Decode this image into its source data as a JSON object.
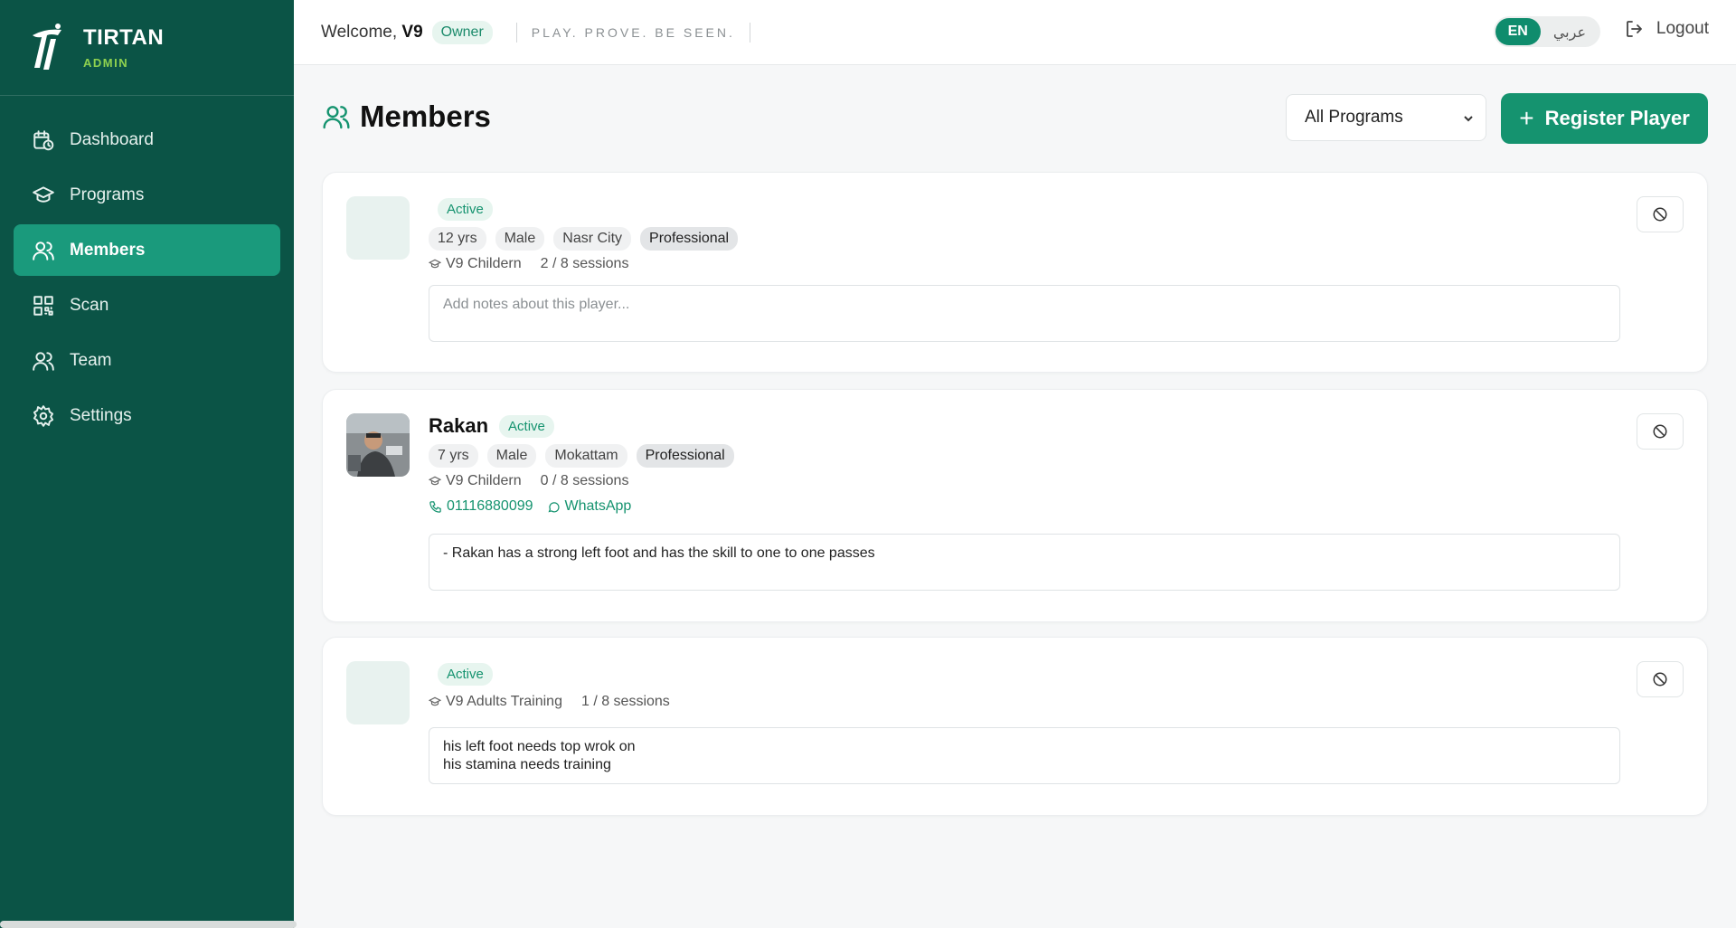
{
  "brand": {
    "name": "TIRTAN",
    "sub": "ADMIN"
  },
  "sidebar": {
    "items": [
      {
        "label": "Dashboard",
        "icon": "calendar-clock-icon"
      },
      {
        "label": "Programs",
        "icon": "graduation-cap-icon"
      },
      {
        "label": "Members",
        "icon": "users-icon",
        "active": true
      },
      {
        "label": "Scan",
        "icon": "qr-code-icon"
      },
      {
        "label": "Team",
        "icon": "users-icon"
      },
      {
        "label": "Settings",
        "icon": "gear-icon"
      }
    ]
  },
  "header": {
    "welcome_prefix": "Welcome,",
    "username": "V9",
    "role": "Owner",
    "tagline": "PLAY. PROVE. BE SEEN.",
    "lang_en": "EN",
    "lang_ar": "عربي",
    "logout": "Logout"
  },
  "main": {
    "title": "Members",
    "program_filter": "All Programs",
    "register_label": "Register Player"
  },
  "members": [
    {
      "name": "",
      "status": "Active",
      "tags": [
        "12 yrs",
        "Male",
        "Nasr City",
        "Professional"
      ],
      "program": "V9 Childern",
      "sessions": "2 / 8 sessions",
      "notes": "",
      "notes_placeholder": "Add notes about this player..."
    },
    {
      "name": "Rakan",
      "status": "Active",
      "tags": [
        "7 yrs",
        "Male",
        "Mokattam",
        "Professional"
      ],
      "program": "V9 Childern",
      "sessions": "0 / 8 sessions",
      "phone": "01116880099",
      "whatsapp": "WhatsApp",
      "notes": "- Rakan has a strong left foot and has the skill to one to one passes"
    },
    {
      "name": "",
      "status": "Active",
      "tags": [],
      "program": "V9 Adults Training",
      "sessions": "1 / 8 sessions",
      "notes": "his left foot needs top wrok on\nhis stamina needs training"
    }
  ],
  "colors": {
    "sidebar": "#0b5446",
    "accent": "#15936f",
    "active_nav": "#1a9a7c",
    "brand_sub": "#8fd14f"
  }
}
